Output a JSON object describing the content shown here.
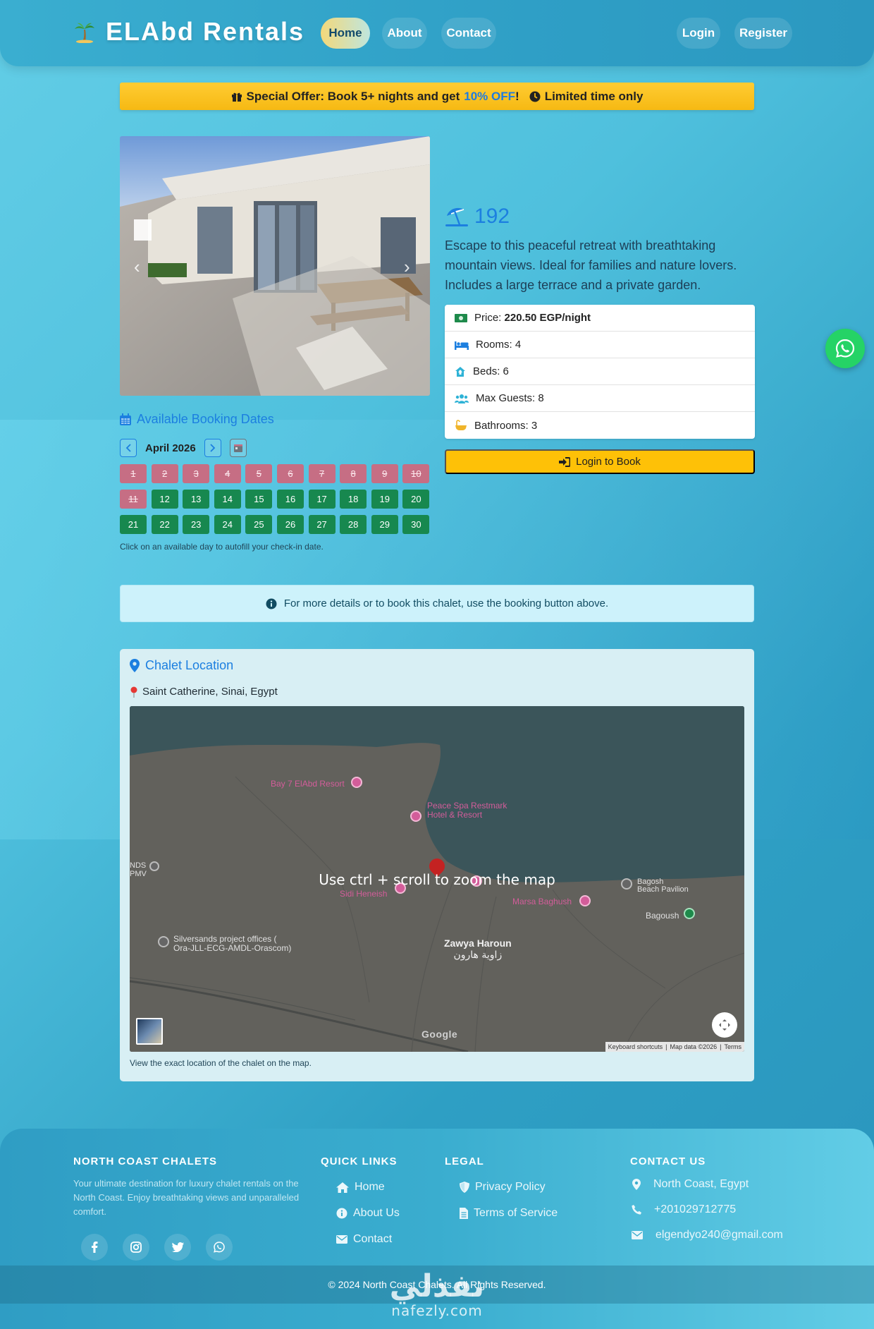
{
  "brand": {
    "name": "ELAbd Rentals",
    "icon": "palm-tree-icon"
  },
  "nav": {
    "home": "Home",
    "about": "About",
    "contact": "Contact",
    "login": "Login",
    "register": "Register"
  },
  "offer": {
    "text_before": "Special Offer: Book 5+ nights and get",
    "highlight": "10% OFF",
    "text_after": "!",
    "limited": "Limited time only",
    "bg_color": "#fec107",
    "highlight_color": "#1e7ce0"
  },
  "chalet": {
    "title": "192",
    "description": "Escape to this peaceful retreat with breathtaking mountain views. Ideal for families and nature lovers. Includes a large terrace and a private garden.",
    "price_label": "Price:",
    "price_value": "220.50 EGP/night",
    "rooms": "Rooms: 4",
    "beds": "Beds: 6",
    "max_guests": "Max Guests: 8",
    "bathrooms": "Bathrooms: 3",
    "book_button": "Login to Book"
  },
  "calendar": {
    "title": "Available Booking Dates",
    "month": "April 2026",
    "note": "Click on an available day to autofill your check-in date.",
    "days": [
      {
        "n": "1",
        "booked": true
      },
      {
        "n": "2",
        "booked": true
      },
      {
        "n": "3",
        "booked": true
      },
      {
        "n": "4",
        "booked": true
      },
      {
        "n": "5",
        "booked": true
      },
      {
        "n": "6",
        "booked": true
      },
      {
        "n": "7",
        "booked": true
      },
      {
        "n": "8",
        "booked": true
      },
      {
        "n": "9",
        "booked": true
      },
      {
        "n": "10",
        "booked": true
      },
      {
        "n": "11",
        "booked": true
      },
      {
        "n": "12",
        "booked": false
      },
      {
        "n": "13",
        "booked": false
      },
      {
        "n": "14",
        "booked": false
      },
      {
        "n": "15",
        "booked": false
      },
      {
        "n": "16",
        "booked": false
      },
      {
        "n": "17",
        "booked": false
      },
      {
        "n": "18",
        "booked": false
      },
      {
        "n": "19",
        "booked": false
      },
      {
        "n": "20",
        "booked": false
      },
      {
        "n": "21",
        "booked": false
      },
      {
        "n": "22",
        "booked": false
      },
      {
        "n": "23",
        "booked": false
      },
      {
        "n": "24",
        "booked": false
      },
      {
        "n": "25",
        "booked": false
      },
      {
        "n": "26",
        "booked": false
      },
      {
        "n": "27",
        "booked": false
      },
      {
        "n": "28",
        "booked": false
      },
      {
        "n": "29",
        "booked": false
      },
      {
        "n": "30",
        "booked": false
      }
    ],
    "booked_color": "#c66e84",
    "free_color": "#17884f"
  },
  "info_bar": {
    "text": "For more details or to book this chalet, use the booking button above."
  },
  "location": {
    "title": "Chalet Location",
    "address": "Saint Catherine, Sinai, Egypt",
    "map_message": "Use ctrl + scroll to zoom the map",
    "note": "View the exact location of the chalet on the map.",
    "labels": {
      "bay7": "Bay 7 ElAbd Resort",
      "peace1": "Peace Spa Restmark",
      "peace2": "Hotel & Resort",
      "sidi": "Sidi Heneish",
      "marsa": "Marsa Baghush",
      "bagosh1": "Bagosh",
      "bagosh2": "Beach Pavilion",
      "bagoush": "Bagoush",
      "silver1": "Silversands project offices (",
      "silver2": "Ora-JLL-ECG-AMDL-Orascom)",
      "zawya_en": "Zawya Haroun",
      "zawya_ar": "زاوية هارون",
      "nds1": "NDS",
      "nds2": "PMV",
      "google": "Google"
    },
    "credits": {
      "keyboard": "Keyboard shortcuts",
      "data": "Map data ©2026",
      "terms": "Terms"
    }
  },
  "footer": {
    "about_title": "NORTH COAST CHALETS",
    "about_text": "Your ultimate destination for luxury chalet rentals on the North Coast. Enjoy breathtaking views and unparalleled comfort.",
    "quick_title": "QUICK LINKS",
    "quick_home": "Home",
    "quick_about": "About Us",
    "quick_contact": "Contact",
    "legal_title": "LEGAL",
    "legal_privacy": "Privacy Policy",
    "legal_terms": "Terms of Service",
    "contact_title": "CONTACT US",
    "contact_address": "North Coast, Egypt",
    "contact_phone": "+201029712775",
    "contact_email": "elgendyo240@gmail.com",
    "copyright": "© 2024 North Coast Chalets. All Rights Reserved."
  },
  "watermark": {
    "ar": "نفذلي",
    "en": "nafezly.com"
  }
}
